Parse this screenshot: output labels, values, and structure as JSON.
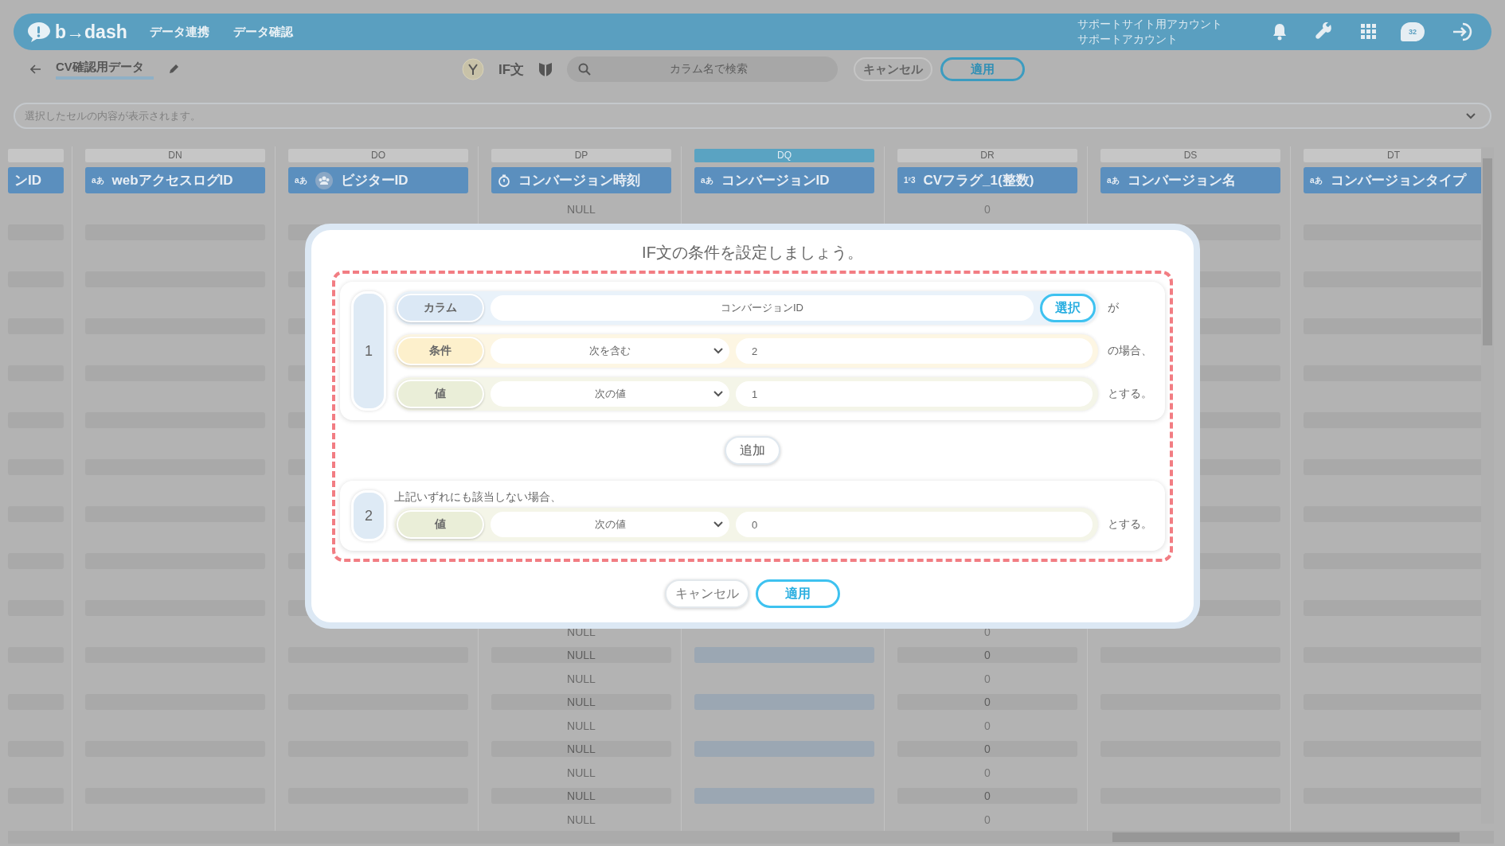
{
  "header": {
    "logo": "b→dash",
    "nav": [
      "データ連携",
      "データ確認"
    ],
    "account": [
      "サポートサイト用アカウント",
      "サポートアカウント"
    ],
    "chat_badge": "32"
  },
  "toolbar": {
    "title": "CV確認用データ",
    "mode": "IF文",
    "search": {
      "placeholder": "カラム名で検索"
    },
    "buttons": [
      {
        "label": "キャンセル",
        "primary": false
      },
      {
        "label": "適用",
        "primary": true
      }
    ]
  },
  "cell_bar": {
    "placeholder": "選択したセルの内容が表示されます。"
  },
  "table": {
    "columns": [
      {
        "name": "ンID",
        "kind": "partial",
        "selected": false
      },
      {
        "letter": "DN",
        "name": "webアクセスログID",
        "kind": "string",
        "type_mark": "aあ",
        "selected": false
      },
      {
        "letter": "DO",
        "name": "ビジターID",
        "kind": "user",
        "type_mark": "aあ",
        "selected": false
      },
      {
        "letter": "DP",
        "name": "コンバージョン時刻",
        "kind": "datetime",
        "selected": false
      },
      {
        "letter": "DQ",
        "name": "コンバージョンID",
        "kind": "string",
        "type_mark": "aあ",
        "selected": true
      },
      {
        "letter": "DR",
        "name": "CVフラグ_1(整数)",
        "kind": "number",
        "type_mark": "1²3",
        "selected": false
      },
      {
        "letter": "DS",
        "name": "コンバージョン名",
        "kind": "string",
        "type_mark": "aあ",
        "selected": false
      },
      {
        "letter": "DT",
        "name": "コンバージョンタイプ",
        "kind": "string",
        "type_mark": "aあ",
        "selected": false
      }
    ],
    "rows_top": [
      {
        "DP": "NULL",
        "DR": "0"
      }
    ],
    "rows_bottom": [
      {
        "DP": "NULL",
        "DR": "0"
      },
      {
        "DP": "NULL",
        "DR": "0"
      },
      {
        "DP": "NULL",
        "DR": "0"
      },
      {
        "DP": "NULL",
        "DR": "0"
      },
      {
        "DP": "NULL",
        "DR": "0"
      },
      {
        "DP": "NULL",
        "DR": "0"
      },
      {
        "DP": "NULL",
        "DR": "0"
      },
      {
        "DP": "NULL",
        "DR": "0"
      },
      {
        "DP": "NULL",
        "DR": "0"
      }
    ]
  },
  "dialog": {
    "title": "IF文の条件を設定しましょう。",
    "conditions": [
      {
        "number": "1",
        "rows": [
          {
            "kind": "column",
            "label": "カラム",
            "value": "コンバージョンID",
            "button": "選択",
            "suffix": "が"
          },
          {
            "kind": "condition",
            "label": "条件",
            "select": "次を含む",
            "value": "2",
            "suffix": "の場合、"
          },
          {
            "kind": "value",
            "label": "値",
            "select": "次の値",
            "value": "1",
            "suffix": "とする。"
          }
        ]
      }
    ],
    "add_button": "追加",
    "otherwise": {
      "number": "2",
      "note": "上記いずれにも該当しない場合、",
      "rows": [
        {
          "kind": "value",
          "label": "値",
          "select": "次の値",
          "value": "0",
          "suffix": "とする。"
        }
      ]
    },
    "buttons": [
      {
        "label": "キャンセル",
        "primary": false
      },
      {
        "label": "適用",
        "primary": true
      }
    ]
  }
}
